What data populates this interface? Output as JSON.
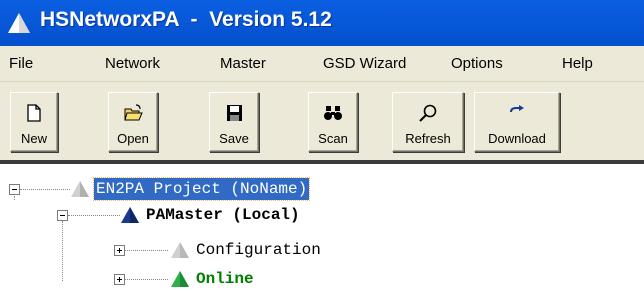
{
  "window": {
    "title": "HSNetworxPA  -  Version 5.12",
    "title_icon": "triangle-app-icon"
  },
  "menu": [
    "File",
    "Network",
    "Master",
    "GSD Wizard",
    "Options",
    "Help"
  ],
  "toolbar": [
    {
      "label": "New",
      "icon": "new-file-icon"
    },
    {
      "label": "Open",
      "icon": "open-folder-icon"
    },
    {
      "label": "Save",
      "icon": "floppy-disk-icon"
    },
    {
      "label": "Scan",
      "icon": "binoculars-icon"
    },
    {
      "label": "Refresh",
      "icon": "magnifier-icon"
    },
    {
      "label": "Download",
      "icon": "download-arrow-icon"
    }
  ],
  "tree": {
    "root": {
      "label": "EN2PA Project (NoName)",
      "expanded": true,
      "selected": true,
      "icon_color": "#c8c8c8"
    },
    "master": {
      "label": "PAMaster (Local)",
      "expanded": true,
      "icon_color": "#1a3a8f"
    },
    "children": [
      {
        "label": "Configuration",
        "expanded": false,
        "icon_color": "#c8c8c8"
      },
      {
        "label": "Online",
        "expanded": false,
        "icon_color": "#1e9a3c"
      }
    ]
  },
  "colors": {
    "titlebar": "#0858d8",
    "selection": "#316ac5",
    "online": "#008000"
  }
}
